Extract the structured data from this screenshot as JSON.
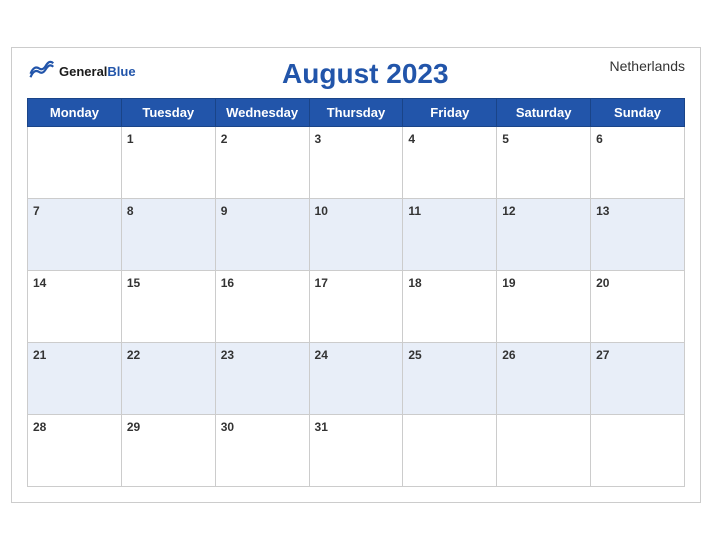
{
  "header": {
    "logo_general": "General",
    "logo_blue": "Blue",
    "title": "August 2023",
    "country": "Netherlands"
  },
  "days_of_week": [
    "Monday",
    "Tuesday",
    "Wednesday",
    "Thursday",
    "Friday",
    "Saturday",
    "Sunday"
  ],
  "weeks": [
    [
      "",
      "1",
      "2",
      "3",
      "4",
      "5",
      "6"
    ],
    [
      "7",
      "8",
      "9",
      "10",
      "11",
      "12",
      "13"
    ],
    [
      "14",
      "15",
      "16",
      "17",
      "18",
      "19",
      "20"
    ],
    [
      "21",
      "22",
      "23",
      "24",
      "25",
      "26",
      "27"
    ],
    [
      "28",
      "29",
      "30",
      "31",
      "",
      "",
      ""
    ]
  ]
}
